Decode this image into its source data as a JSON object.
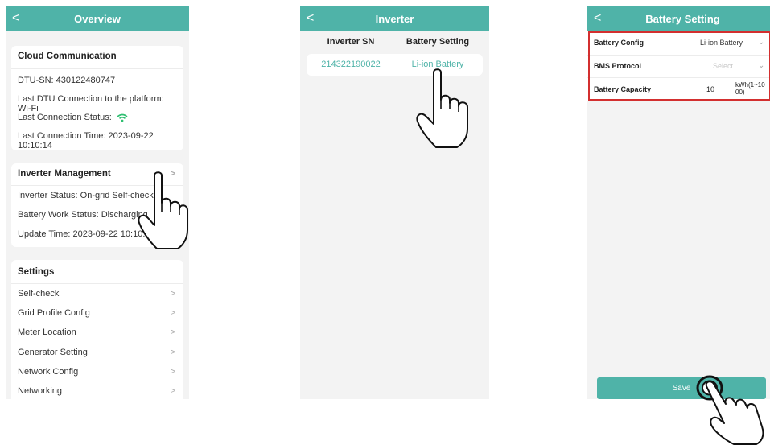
{
  "overview": {
    "header_title": "Overview",
    "back": "<",
    "cloud": {
      "title": "Cloud Communication",
      "dtu_sn": "DTU-SN:  430122480747",
      "last_conn_platform": "Last DTU Connection to the platform:  Wi-Fi",
      "last_conn_status": "Last Connection Status:",
      "last_conn_time": "Last Connection Time:  2023-09-22 10:10:14"
    },
    "inverter_mgmt": {
      "title": "Inverter Management",
      "status": "Inverter Status:  On-grid Self-check",
      "battery_status": "Battery Work Status:  Discharging",
      "update_time": "Update Time:  2023-09-22 10:10:47"
    },
    "settings": {
      "title": "Settings",
      "items": [
        "Self-check",
        "Grid Profile Config",
        "Meter Location",
        "Generator Setting",
        "Network Config",
        "Networking"
      ]
    }
  },
  "inverter": {
    "header_title": "Inverter",
    "back": "<",
    "col_sn": "Inverter SN",
    "col_battery": "Battery Setting",
    "row_sn": "214322190022",
    "row_battery": "Li-ion Battery"
  },
  "battery": {
    "header_title": "Battery Setting",
    "back": "<",
    "config_label": "Battery Config",
    "config_value": "Li-ion Battery",
    "bms_label": "BMS Protocol",
    "bms_placeholder": "Select",
    "capacity_label": "Battery Capacity",
    "capacity_value": "10",
    "capacity_unit": "kWh(1~1000)",
    "save_label": "Save"
  },
  "colors": {
    "accent": "#4fb3a8",
    "highlight_border": "#d32f2f",
    "wifi": "#2fbf71"
  },
  "icons": [
    "back-chevron-icon",
    "chevron-right-icon",
    "chevron-down-icon",
    "wifi-icon",
    "pointing-hand-icon",
    "tap-hand-icon"
  ]
}
